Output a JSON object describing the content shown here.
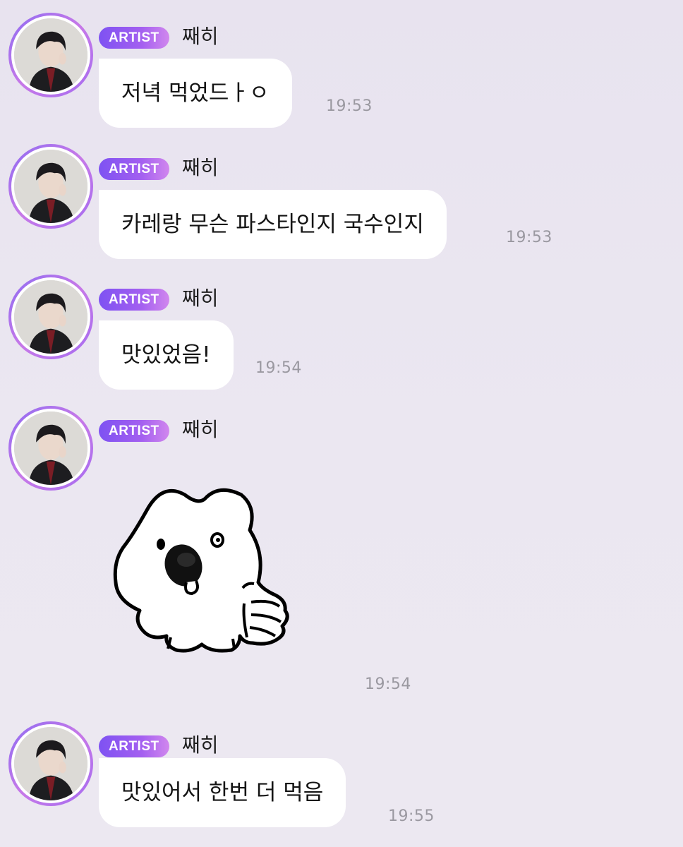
{
  "messages": [
    {
      "badge": "ARTIST",
      "sender": "째히",
      "text": "저녁 먹었드ㅏㅇ",
      "time": "19:53"
    },
    {
      "badge": "ARTIST",
      "sender": "째히",
      "text": "카레랑 무슨 파스타인지 국수인지",
      "time": "19:53"
    },
    {
      "badge": "ARTIST",
      "sender": "째히",
      "text": "맛있었음!",
      "time": "19:54"
    },
    {
      "badge": "ARTIST",
      "sender": "째히",
      "sticker": "white-dog-thumbs-up-sticker",
      "time": "19:54"
    },
    {
      "badge": "ARTIST",
      "sender": "째히",
      "text": "맛있어서 한번 더 먹음",
      "time": "19:55"
    }
  ],
  "colors": {
    "badge_start": "#7e52f2",
    "badge_end": "#d187ee",
    "avatar_ring": "#a56cf0",
    "background": "#ebe7f1",
    "bubble": "#ffffff",
    "time_text": "#9a98a0"
  }
}
